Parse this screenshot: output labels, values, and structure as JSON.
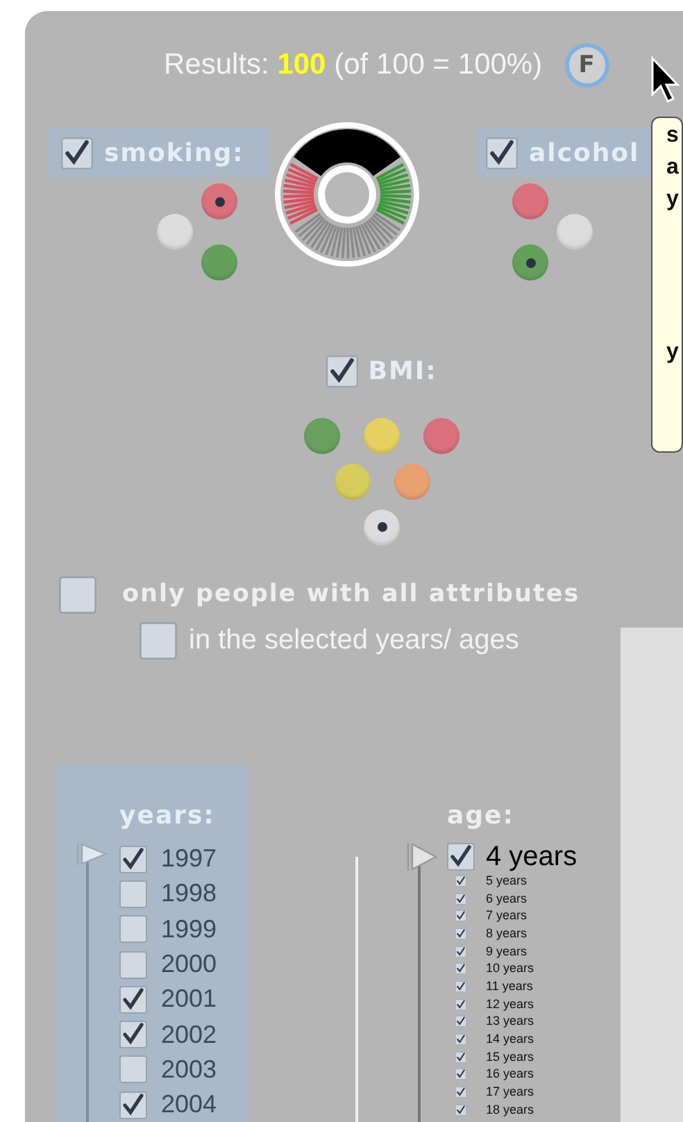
{
  "results": {
    "text": "Results: **100** (of 100 = 100%)"
  },
  "filter_button": {
    "label": "F"
  },
  "tooltip": {
    "lines": [
      "s",
      "a",
      "y",
      "y"
    ]
  },
  "attributes": [
    {
      "kind": "boxed",
      "label": "smoking:",
      "checked": true,
      "options": [
        {
          "color": "#d9707c",
          "selected": true
        },
        {
          "color": "#dcdcdc",
          "selected": false
        },
        {
          "color": "#64a05c",
          "selected": false
        }
      ]
    },
    {
      "kind": "boxed",
      "label": "alcohol",
      "checked": true,
      "options": [
        {
          "color": "#d9707c",
          "selected": false
        },
        {
          "color": "#dcdcdc",
          "selected": false
        },
        {
          "color": "#64a05c",
          "selected": true
        }
      ]
    },
    {
      "kind": "plain",
      "label": "BMI:",
      "checked": true,
      "options": [
        {
          "color": "#68a05e",
          "selected": false
        },
        {
          "color": "#e6d060",
          "selected": false
        },
        {
          "color": "#d9707c",
          "selected": false
        },
        {
          "color": "#d6cc5c",
          "selected": false
        },
        {
          "color": "#e8a070",
          "selected": false
        },
        {
          "color": "#dcdcdc",
          "selected": true
        }
      ]
    }
  ],
  "all_attributes": {
    "label": "only people with all attributes",
    "checked": false
  },
  "selected_years_ages": {
    "label": "in the selected years/ ages",
    "checked": false
  },
  "years": {
    "title": "years:",
    "items": [
      {
        "label": "1997",
        "checked": true
      },
      {
        "label": "1998",
        "checked": false
      },
      {
        "label": "1999",
        "checked": false
      },
      {
        "label": "2000",
        "checked": false
      },
      {
        "label": "2001",
        "checked": true
      },
      {
        "label": "2002",
        "checked": true
      },
      {
        "label": "2003",
        "checked": false
      },
      {
        "label": "2004",
        "checked": true
      }
    ]
  },
  "ages": {
    "title": "age:",
    "items": [
      {
        "kind": "large",
        "label": "4 years",
        "checked": true
      },
      {
        "kind": "small",
        "label": "5 years",
        "checked": true
      },
      {
        "kind": "small",
        "label": "6 years",
        "checked": true
      },
      {
        "kind": "small",
        "label": "7 years",
        "checked": true
      },
      {
        "kind": "small",
        "label": "8 years",
        "checked": true
      },
      {
        "kind": "small",
        "label": "9 years",
        "checked": true
      },
      {
        "kind": "small",
        "label": "10 years",
        "checked": true
      },
      {
        "kind": "small",
        "label": "11 years",
        "checked": true
      },
      {
        "kind": "small",
        "label": "12 years",
        "checked": true
      },
      {
        "kind": "small",
        "label": "13 years",
        "checked": true
      },
      {
        "kind": "small",
        "label": "14 years",
        "checked": true
      },
      {
        "kind": "small",
        "label": "15 years",
        "checked": true
      },
      {
        "kind": "small",
        "label": "16 years",
        "checked": true
      },
      {
        "kind": "small",
        "label": "17 years",
        "checked": true
      },
      {
        "kind": "small",
        "label": "18 years",
        "checked": true
      }
    ]
  }
}
